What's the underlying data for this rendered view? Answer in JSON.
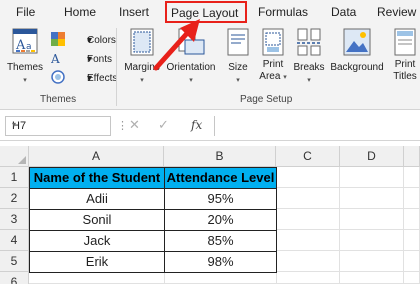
{
  "tabs": [
    "File",
    "Home",
    "Insert",
    "Page Layout",
    "Formulas",
    "Data",
    "Review"
  ],
  "ribbon": {
    "themes": {
      "themes_label": "Themes",
      "colors_label": "Colors",
      "fonts_label": "Fonts",
      "effects_label": "Effects",
      "group_label": "Themes"
    },
    "page_setup": {
      "margins_label": "Margins",
      "orientation_label": "Orientation",
      "size_label": "Size",
      "print_area_label_1": "Print",
      "print_area_label_2": "Area",
      "breaks_label": "Breaks",
      "background_label": "Background",
      "print_titles_label_1": "Print",
      "print_titles_label_2": "Titles",
      "group_label": "Page Setup"
    }
  },
  "formula_bar": {
    "name_box": "H7",
    "fx_label": "fx",
    "cancel_symbol": "✕",
    "enter_symbol": "✓",
    "content": ""
  },
  "sheet": {
    "columns": [
      "A",
      "B",
      "C",
      "D"
    ],
    "rows": [
      "1",
      "2",
      "3",
      "4",
      "5",
      "6"
    ],
    "headers": [
      "Name of the Student",
      "Attendance Level"
    ],
    "data": [
      [
        "Adii",
        "95%"
      ],
      [
        "Sonil",
        "20%"
      ],
      [
        "Jack",
        "85%"
      ],
      [
        "Erik",
        "98%"
      ]
    ]
  },
  "colors": {
    "header_fill": "#00b0f0",
    "highlight_border": "#e8211a",
    "arrow": "#e8211a"
  }
}
